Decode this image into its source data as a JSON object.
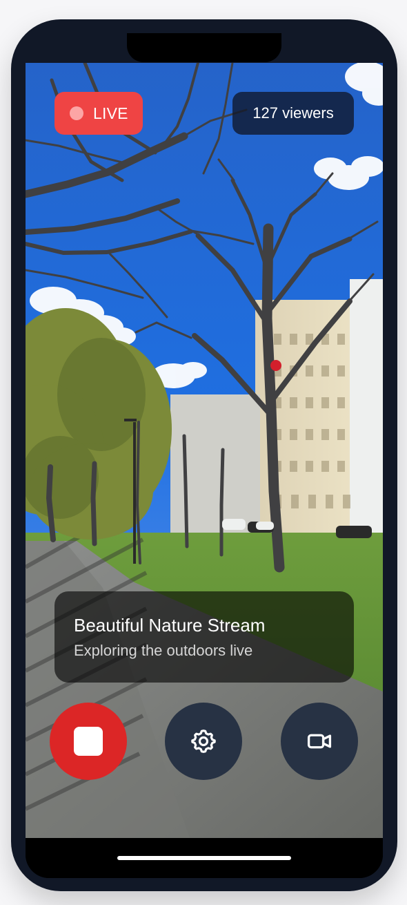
{
  "stream": {
    "live_label": "LIVE",
    "viewer_count_text": "127 viewers",
    "title": "Beautiful Nature Stream",
    "subtitle": "Exploring the outdoors live"
  },
  "controls": {
    "record_icon": "stop-square-icon",
    "settings_icon": "gear-icon",
    "camera_icon": "video-camera-icon"
  },
  "colors": {
    "live_red": "#ef4444",
    "record_red": "#dc2626",
    "control_dark": "#273244",
    "phone_frame": "#111827"
  }
}
